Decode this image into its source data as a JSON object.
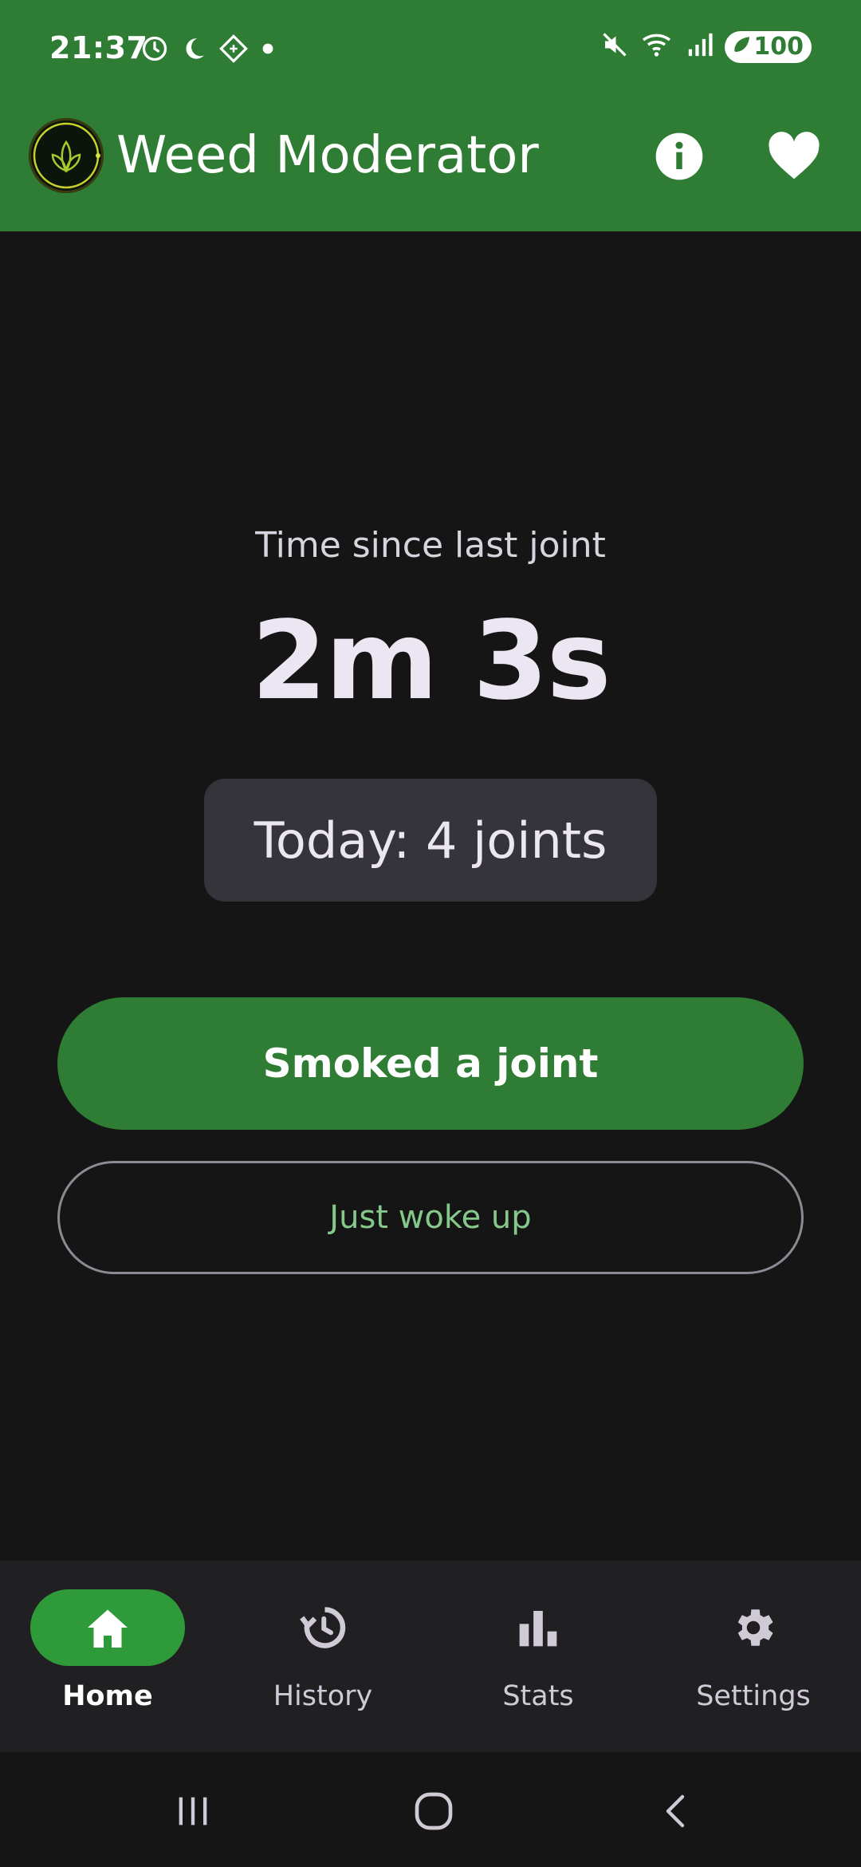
{
  "status_bar": {
    "time": "21:37",
    "battery": "100",
    "left_icons": [
      "alarm-icon",
      "moon-icon",
      "nfc-diamond-icon",
      "dot-icon"
    ],
    "right_icons": [
      "mute-icon",
      "wifi-icon",
      "signal-icon",
      "battery-saver-icon"
    ]
  },
  "app_bar": {
    "title": "Weed Moderator",
    "logo": "leaf-logo-icon",
    "actions": [
      "info-icon",
      "heart-icon"
    ]
  },
  "main": {
    "since_label": "Time since last joint",
    "elapsed": "2m 3s",
    "today_count": "Today: 4 joints",
    "primary_button": "Smoked a joint",
    "secondary_button": "Just woke up"
  },
  "bottom_nav": {
    "items": [
      {
        "label": "Home",
        "icon": "home-icon",
        "active": true
      },
      {
        "label": "History",
        "icon": "history-icon",
        "active": false
      },
      {
        "label": "Stats",
        "icon": "bar-chart-icon",
        "active": false
      },
      {
        "label": "Settings",
        "icon": "gear-icon",
        "active": false
      }
    ]
  },
  "system_nav": {
    "buttons": [
      "recents-icon",
      "home-circle-icon",
      "back-icon"
    ]
  },
  "colors": {
    "primary_green": "#2f7d34",
    "active_pill_green": "#2f9a3a",
    "background": "#151516",
    "chip_bg": "#34343a",
    "nav_bg": "#202022",
    "secondary_text_green": "#85c98a"
  }
}
